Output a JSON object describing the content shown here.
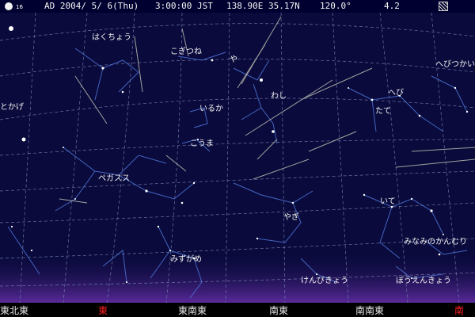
{
  "status": {
    "moon_age": "16",
    "date": "AD 2004/ 5/ 6(Thu)",
    "time": "3:00:00 JST",
    "location": "138.90E 35.17N",
    "azimuth": "120.0°",
    "magnitude": "4.2",
    "toggle_icon": "hatched-square-icon"
  },
  "constellations": [
    {
      "label": "はくちょう"
    },
    {
      "label": "こぎつね"
    },
    {
      "label": "や"
    },
    {
      "label": "へびつかい"
    },
    {
      "label": "とかげ"
    },
    {
      "label": "いるか"
    },
    {
      "label": "わし"
    },
    {
      "label": "へび"
    },
    {
      "label": "たて"
    },
    {
      "label": "こうま"
    },
    {
      "label": "ペガスス"
    },
    {
      "label": "いて"
    },
    {
      "label": "やぎ"
    },
    {
      "label": "みなみのかんむり"
    },
    {
      "label": "みずがめ"
    },
    {
      "label": "けんびきょう"
    },
    {
      "label": "ぼうえんきょう"
    }
  ],
  "horizon": [
    {
      "label": "東北東",
      "color": "#e8e8e8"
    },
    {
      "label": "東",
      "color": "#ff2020"
    },
    {
      "label": "東南東",
      "color": "#e8e8e8"
    },
    {
      "label": "南東",
      "color": "#e8e8e8"
    },
    {
      "label": "南南東",
      "color": "#e8e8e8"
    },
    {
      "label": "南",
      "color": "#ff2020"
    }
  ],
  "colors": {
    "sky": "#0a0a3c",
    "grid": "#7c86b4",
    "constellation_lines": "#4a70d0",
    "horizon_glow": "#5a2a9a",
    "cardinal_highlight": "#ff2020"
  }
}
